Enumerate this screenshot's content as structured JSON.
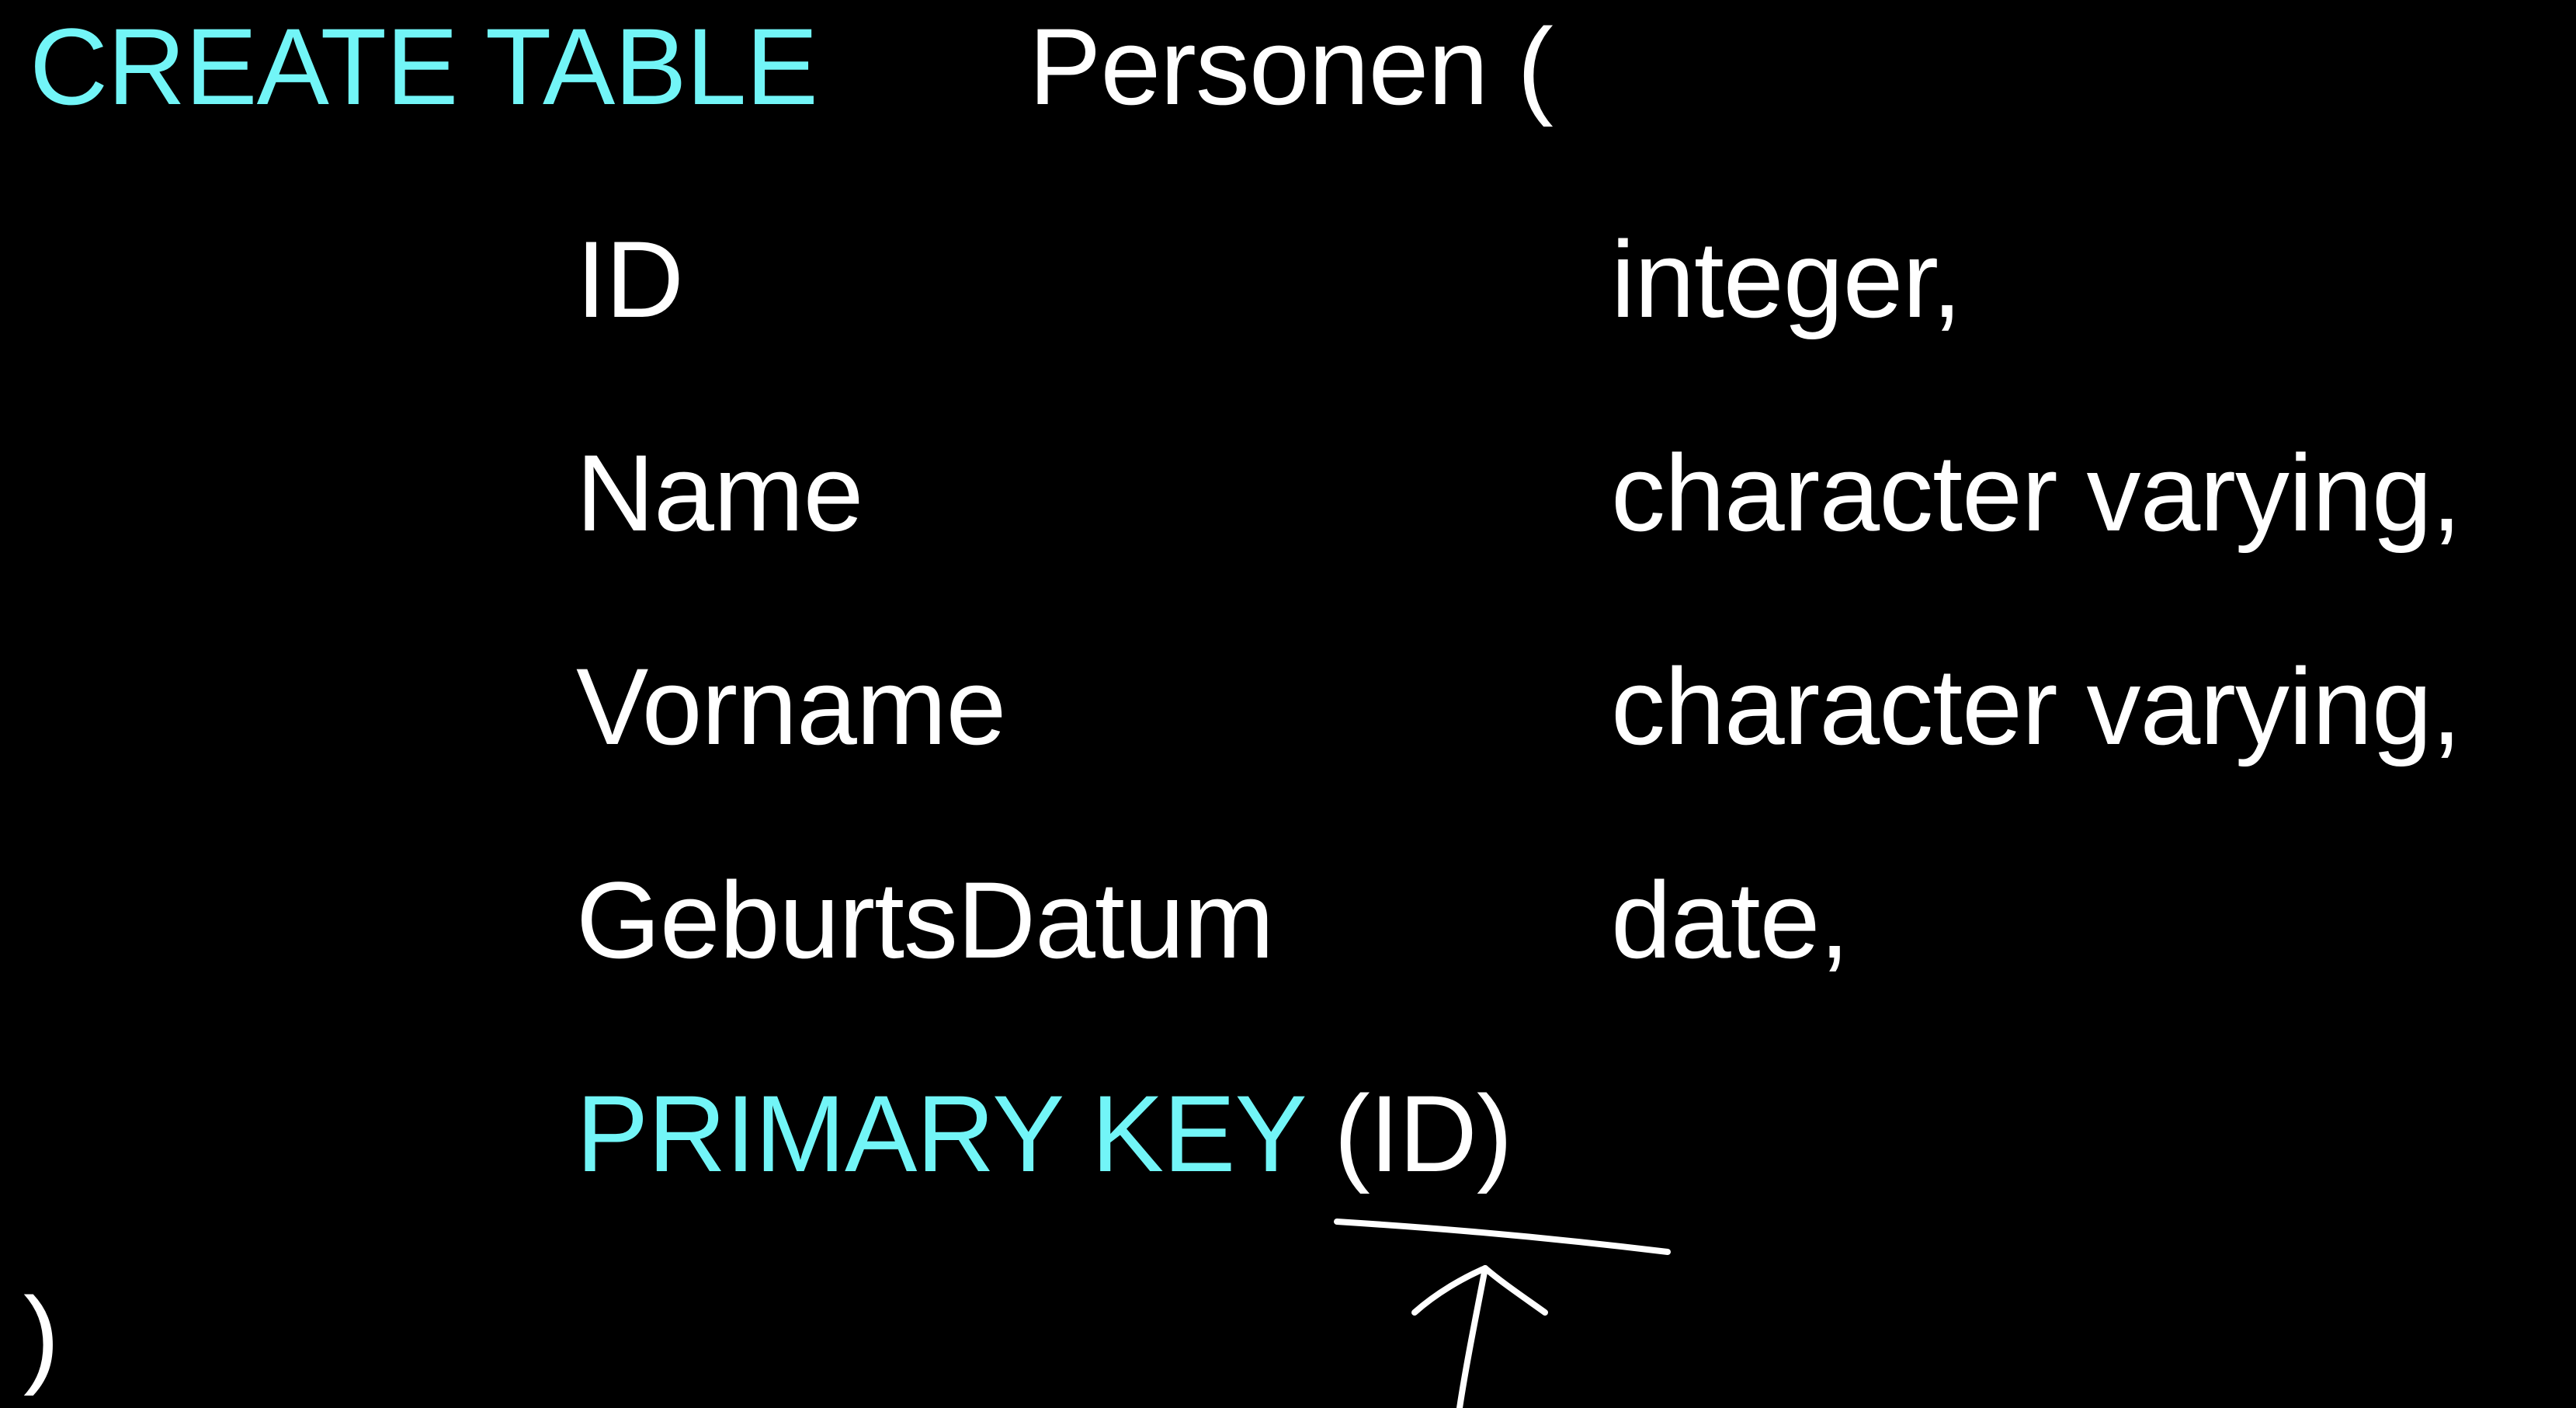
{
  "colors": {
    "background": "#000000",
    "keyword": "#72f5f7",
    "text": "#ffffff"
  },
  "statement": {
    "create_keyword": "CREATE TABLE",
    "table_name": "Personen (",
    "columns": [
      {
        "name": "ID",
        "type": "integer,"
      },
      {
        "name": "Name",
        "type": "character varying,"
      },
      {
        "name": "Vorname",
        "type": "character varying,"
      },
      {
        "name": "GeburtsDatum",
        "type": "date,"
      }
    ],
    "primary_key_keyword": "PRIMARY KEY",
    "primary_key_columns": "(ID)",
    "closing": ")"
  },
  "annotation": {
    "underline_icon": "hand-drawn-underline",
    "arrow_icon": "hand-drawn-up-arrow"
  }
}
